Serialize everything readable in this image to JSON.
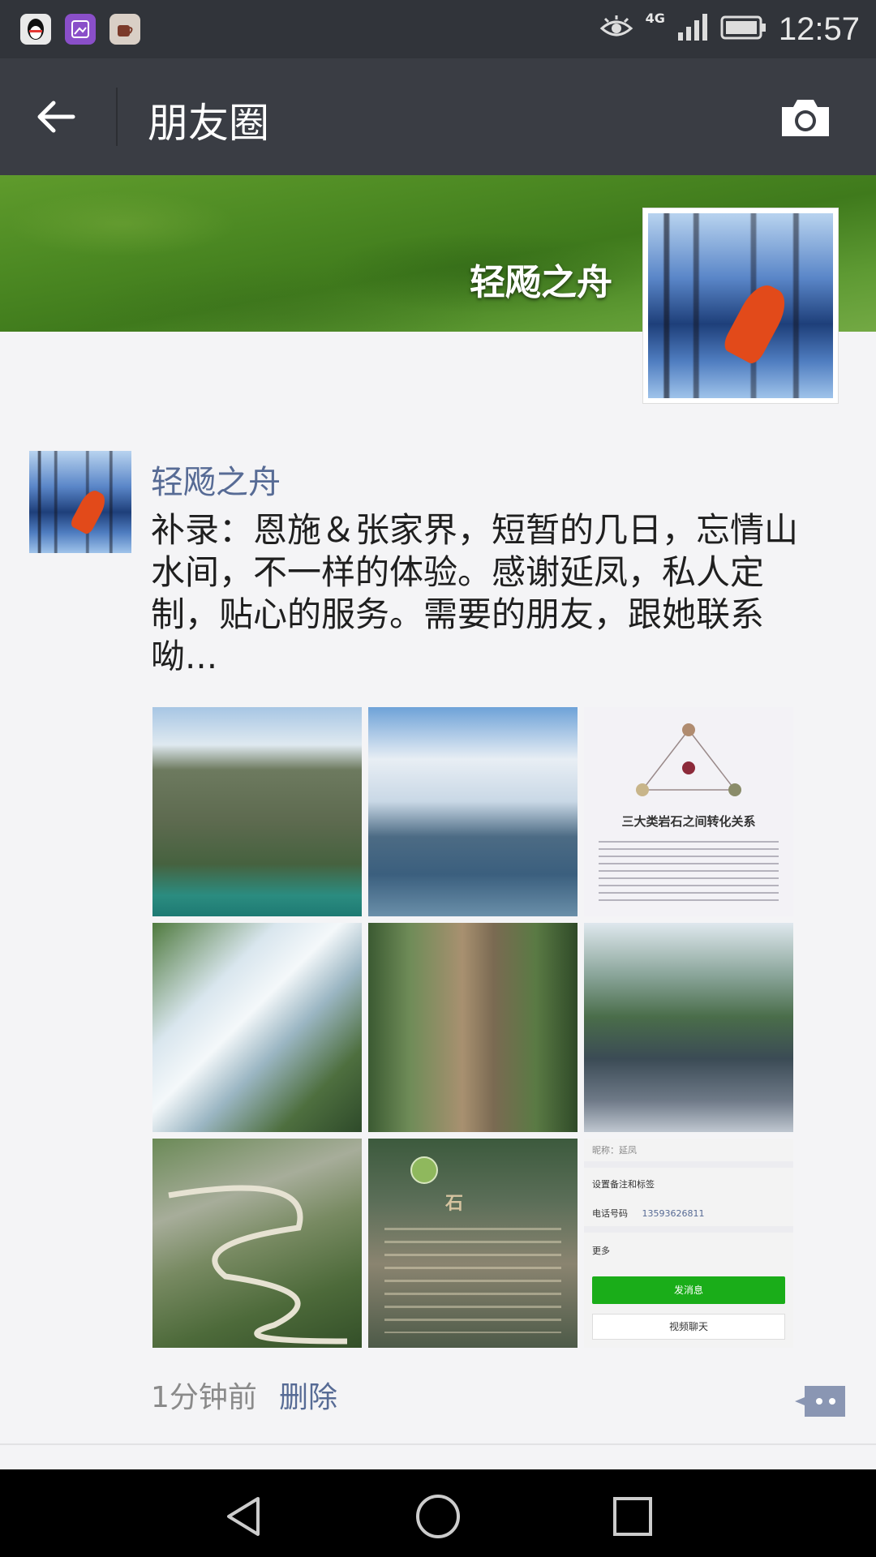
{
  "status_bar": {
    "time": "12:57",
    "network": "4G",
    "icons": [
      "qq-icon",
      "gallery-icon",
      "coffee-icon",
      "eye-icon",
      "signal-icon",
      "battery-icon"
    ]
  },
  "nav": {
    "title": "朋友圈",
    "back_icon": "back-arrow-icon",
    "camera_icon": "camera-icon"
  },
  "cover": {
    "username": "轻飏之舟"
  },
  "post": {
    "author": "轻飏之舟",
    "text": "补录：恩施＆张家界，短暂的几日，忘情山\n水间，不一样的体验。感谢延凤，私人定\n制，贴心的服务。需要的朋友，跟她联系\n呦...",
    "time": "1分钟前",
    "delete_label": "删除",
    "photos": {
      "count": 9,
      "diagram_caption": "三大类岩石之间转化关系",
      "sign_text": "石",
      "contact": {
        "nickname_label": "昵称：延凤",
        "remark_label": "设置备注和标签",
        "phone_label": "电话号码",
        "phone": "13593626811",
        "more_label": "更多",
        "send_label": "发消息",
        "video_label": "视频聊天"
      }
    }
  },
  "colors": {
    "nav_bg": "#3a3d44",
    "status_bg": "#31343a",
    "link": "#576b95",
    "send_button": "#1aad19"
  }
}
